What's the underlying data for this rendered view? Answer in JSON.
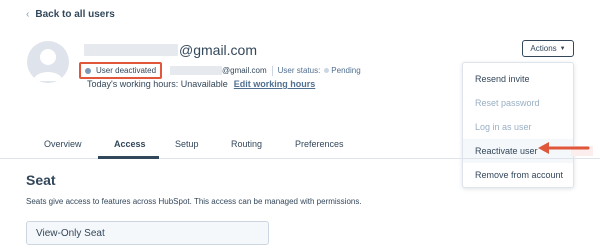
{
  "back_link": {
    "label": "Back to all users",
    "icon": "chevron-left-icon"
  },
  "user": {
    "email_title_suffix": "@gmail.com",
    "status_badge": "User deactivated",
    "email_suffix": "@gmail.com",
    "user_status_label": "User status:",
    "user_status_value": "Pending",
    "working_hours_text": "Today's working hours: Unavailable",
    "edit_hours_link": "Edit working hours"
  },
  "actions": {
    "button_label": "Actions",
    "menu": [
      {
        "label": "Resend invite",
        "disabled": false
      },
      {
        "label": "Reset password",
        "disabled": true
      },
      {
        "label": "Log in as user",
        "disabled": true
      },
      {
        "label": "Reactivate user",
        "disabled": false,
        "highlighted": true
      },
      {
        "label": "Remove from account",
        "disabled": false
      }
    ]
  },
  "tabs": [
    {
      "label": "Overview",
      "active": false
    },
    {
      "label": "Access",
      "active": true
    },
    {
      "label": "Setup",
      "active": false
    },
    {
      "label": "Routing",
      "active": false
    },
    {
      "label": "Preferences",
      "active": false
    }
  ],
  "seat": {
    "title": "Seat",
    "description": "Seats give access to features across HubSpot. This access can be managed with permissions.",
    "selected": "View-Only Seat"
  },
  "colors": {
    "annotation": "#e0573c",
    "text": "#33475b",
    "muted": "#99afc4"
  }
}
